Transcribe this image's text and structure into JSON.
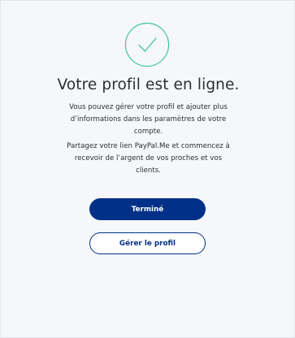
{
  "confirmation": {
    "icon": "check-circle-icon",
    "title": "Votre profil est en ligne.",
    "paragraph_1": "Vous pouvez gérer votre profil et ajouter plus d’informations dans les paramètres de votre compte.",
    "paragraph_2": "Partagez votre lien PayPal.Me et commencez à recevoir de l’argent de vos proches et vos clients."
  },
  "actions": {
    "done_label": "Terminé",
    "manage_label": "Gérer le profil"
  },
  "colors": {
    "accent_check": "#3fc5a0",
    "brand_blue": "#003087",
    "background": "#f5f7fa"
  }
}
